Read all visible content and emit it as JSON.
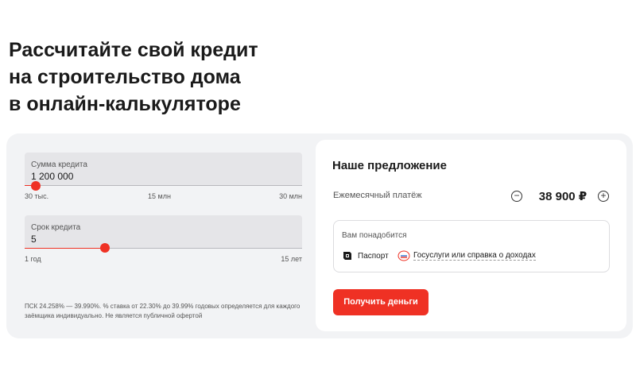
{
  "heading": {
    "line1": "Рассчитайте свой кредит",
    "line2": "на строительство дома",
    "line3": "в онлайн-калькуляторе"
  },
  "calculator": {
    "amount": {
      "label": "Сумма кредита",
      "value": "1 200 000",
      "min_label": "30 тыс.",
      "mid_label": "15 млн",
      "max_label": "30 млн",
      "position_fraction": 0.04
    },
    "term": {
      "label": "Срок кредита",
      "value": "5",
      "min_label": "1 год",
      "max_label": "15 лет",
      "position_fraction": 0.29
    },
    "disclaimer": "ПСК 24.258% — 39.990%. % ставка от 22.30% до 39.99% годовых определяется для каждого заёмщика индивидуально. Не является публичной офертой"
  },
  "offer": {
    "title": "Наше предложение",
    "monthly_label": "Ежемесячный платёж",
    "monthly_amount": "38 900 ₽",
    "minus_symbol": "−",
    "plus_symbol": "+",
    "needs_label": "Вам понадобится",
    "documents": [
      {
        "label": "Паспорт",
        "icon": "passport-icon"
      },
      {
        "label": "Госуслуги или справка о доходах",
        "icon": "gosuslugi-icon"
      }
    ],
    "cta_label": "Получить деньги"
  },
  "colors": {
    "accent": "#ef3124",
    "card_bg": "#f2f3f5",
    "field_bg": "#e5e5e8"
  }
}
